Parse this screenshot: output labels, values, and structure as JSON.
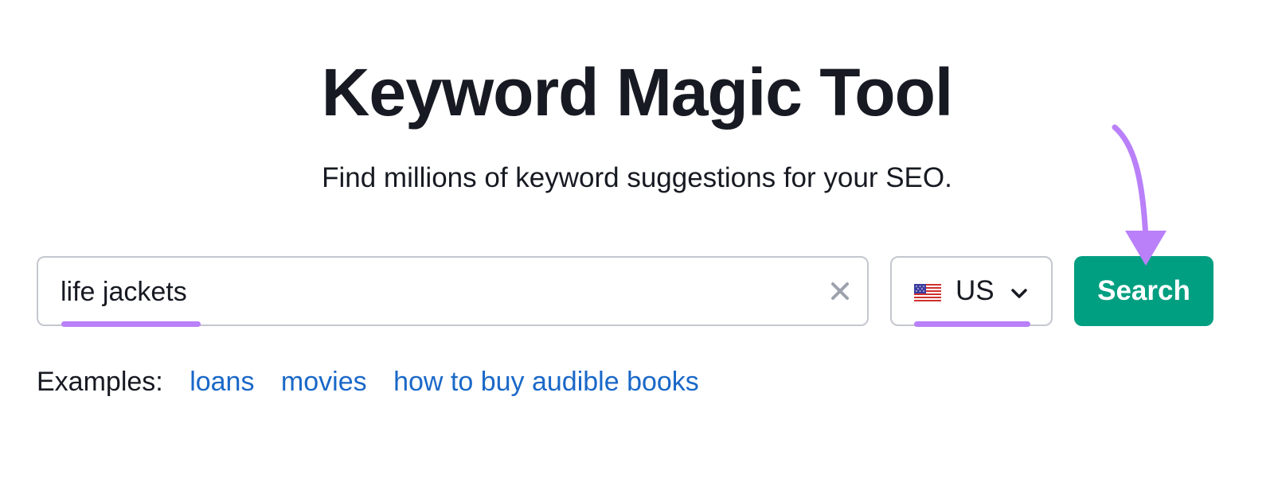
{
  "header": {
    "title": "Keyword Magic Tool",
    "subtitle": "Find millions of keyword suggestions for your SEO."
  },
  "search": {
    "value": "life jackets",
    "placeholder": "",
    "clear_icon": "close-icon"
  },
  "database": {
    "flag_icon": "us-flag-icon",
    "selected": "US",
    "dropdown_icon": "chevron-down-icon"
  },
  "search_button": {
    "label": "Search"
  },
  "examples": {
    "label": "Examples:",
    "items": [
      "loans",
      "movies",
      "how to buy audible books"
    ]
  },
  "colors": {
    "accent_button": "#009f81",
    "annotation": "#b980f9",
    "link": "#1a68c8",
    "text": "#171a22"
  }
}
